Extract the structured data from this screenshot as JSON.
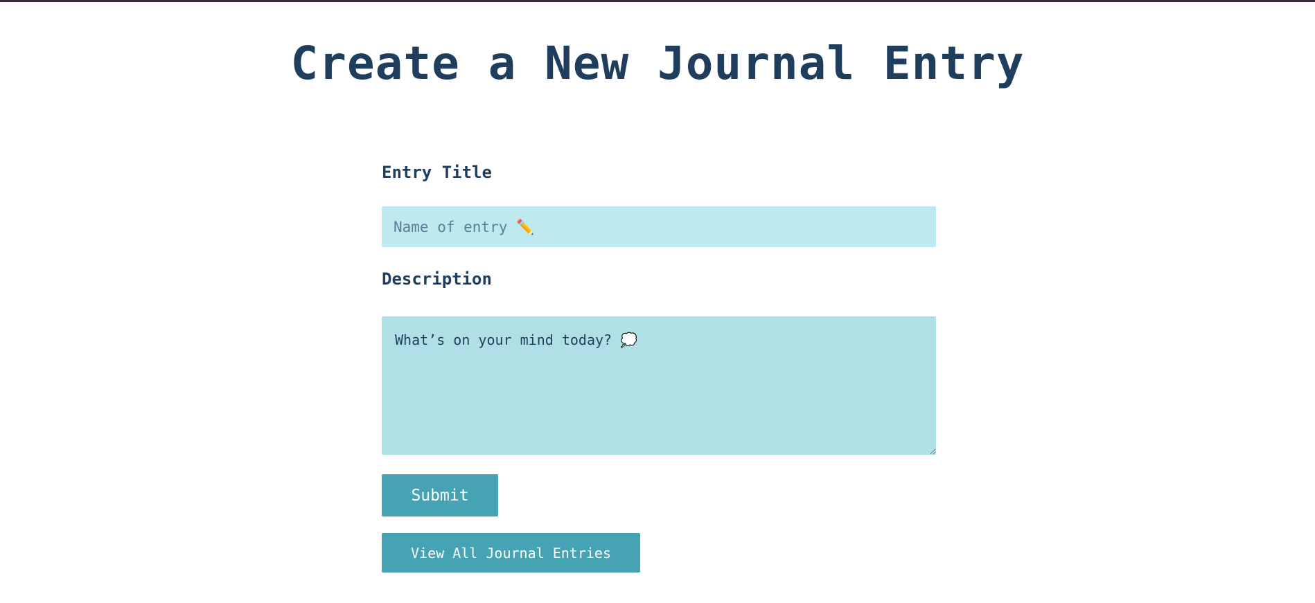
{
  "header": {
    "title": "Create a New Journal Entry"
  },
  "form": {
    "title_label": "Entry Title",
    "title_placeholder": "Name of entry ✏️",
    "description_label": "Description",
    "description_placeholder": "What’s on your mind today? 💭",
    "submit_label": "Submit",
    "view_all_label": "View All Journal Entries"
  },
  "colors": {
    "heading": "#1f3d5c",
    "input_bg": "#bee9ee",
    "textarea_bg": "#b0dfe5",
    "button_bg": "#46a3b3",
    "button_text": "#ffffff"
  }
}
